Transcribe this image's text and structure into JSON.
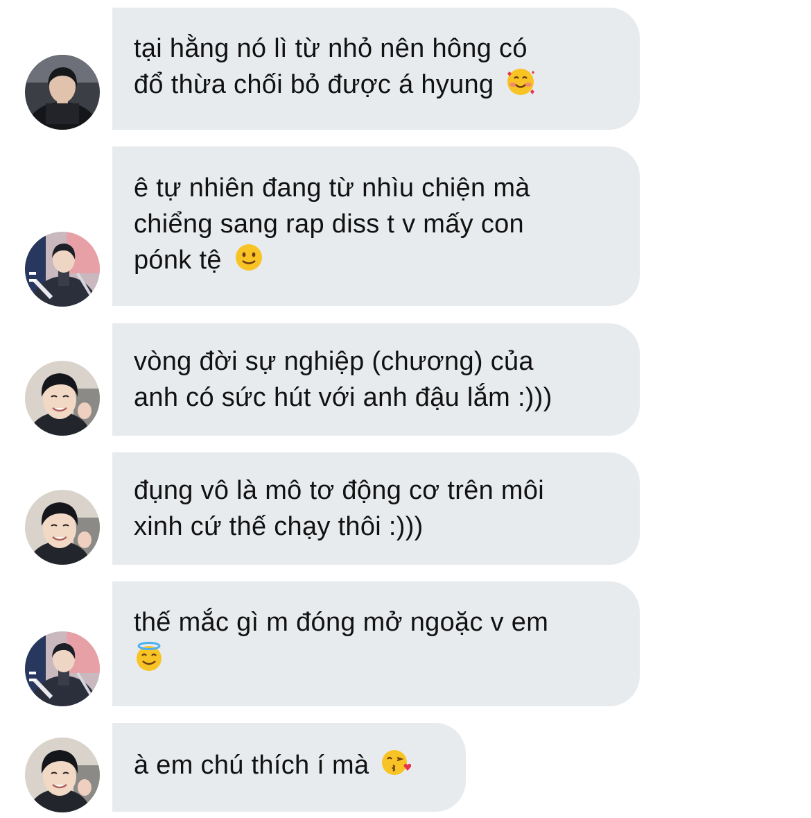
{
  "messages": [
    {
      "avatar": "dark-jacket",
      "text": "tại hằng nó lì từ nhỏ nên hông có\nđổ thừa chối bỏ được á hyung ",
      "emoji": "smiling-face-with-hearts-icon"
    },
    {
      "avatar": "award-trophy",
      "text": "ê tự nhiên đang từ nhìu chiện mà\nchiểng sang rap diss t v mấy con\npónk tệ ",
      "emoji": "slightly-smiling-face-icon"
    },
    {
      "avatar": "smiling-boy",
      "text": "vòng đời sự nghiệp (chương) của\nanh có sức hút với anh đậu lắm :)))",
      "emoji": ""
    },
    {
      "avatar": "smiling-boy",
      "text": "đụng vô là mô tơ động cơ trên môi\nxinh cứ thế chạy thôi :)))",
      "emoji": ""
    },
    {
      "avatar": "award-trophy",
      "text": "thế mắc gì m đóng mở ngoặc v em\n",
      "emoji": "smiling-face-with-halo-icon"
    },
    {
      "avatar": "smiling-boy",
      "text": "à em chú thích í mà ",
      "emoji": "face-blowing-kiss-icon"
    }
  ],
  "colors": {
    "bubble": "#e8ebee",
    "text": "#111111",
    "background": "#ffffff",
    "emoji_yellow": "#f7c325"
  }
}
